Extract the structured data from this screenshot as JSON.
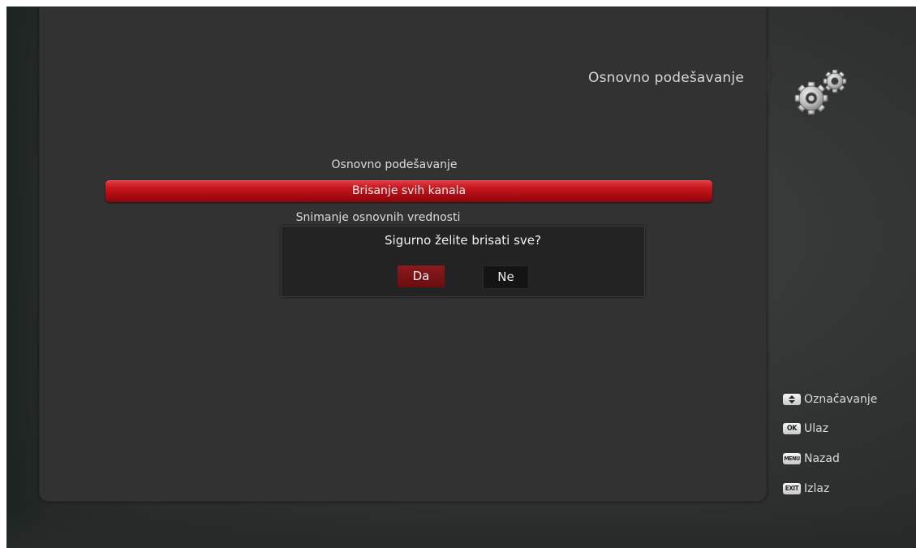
{
  "panel": {
    "title": "Osnovno podešavanje"
  },
  "menu": {
    "items": [
      {
        "label": "Osnovno podešavanje"
      },
      {
        "label": "Brisanje svih kanala"
      },
      {
        "label": "Snimanje osnovnih vrednosti"
      }
    ],
    "selected_index": 1
  },
  "dialog": {
    "message": "Sigurno želite brisati sve?",
    "yes_label": "Da",
    "no_label": "Ne"
  },
  "legend": {
    "items": [
      {
        "key": "▲▼",
        "label": "Označavanje"
      },
      {
        "key": "OK",
        "label": "Ulaz"
      },
      {
        "key": "MENU",
        "label": "Nazad"
      },
      {
        "key": "EXIT",
        "label": "Izlaz"
      }
    ]
  },
  "colors": {
    "highlight": "#c7161d",
    "panel": "#323232",
    "dialog": "#232323",
    "yes_button": "#7a1316"
  },
  "icons": {
    "settings": "gears-icon",
    "nav": "up-down-arrow-icon"
  }
}
